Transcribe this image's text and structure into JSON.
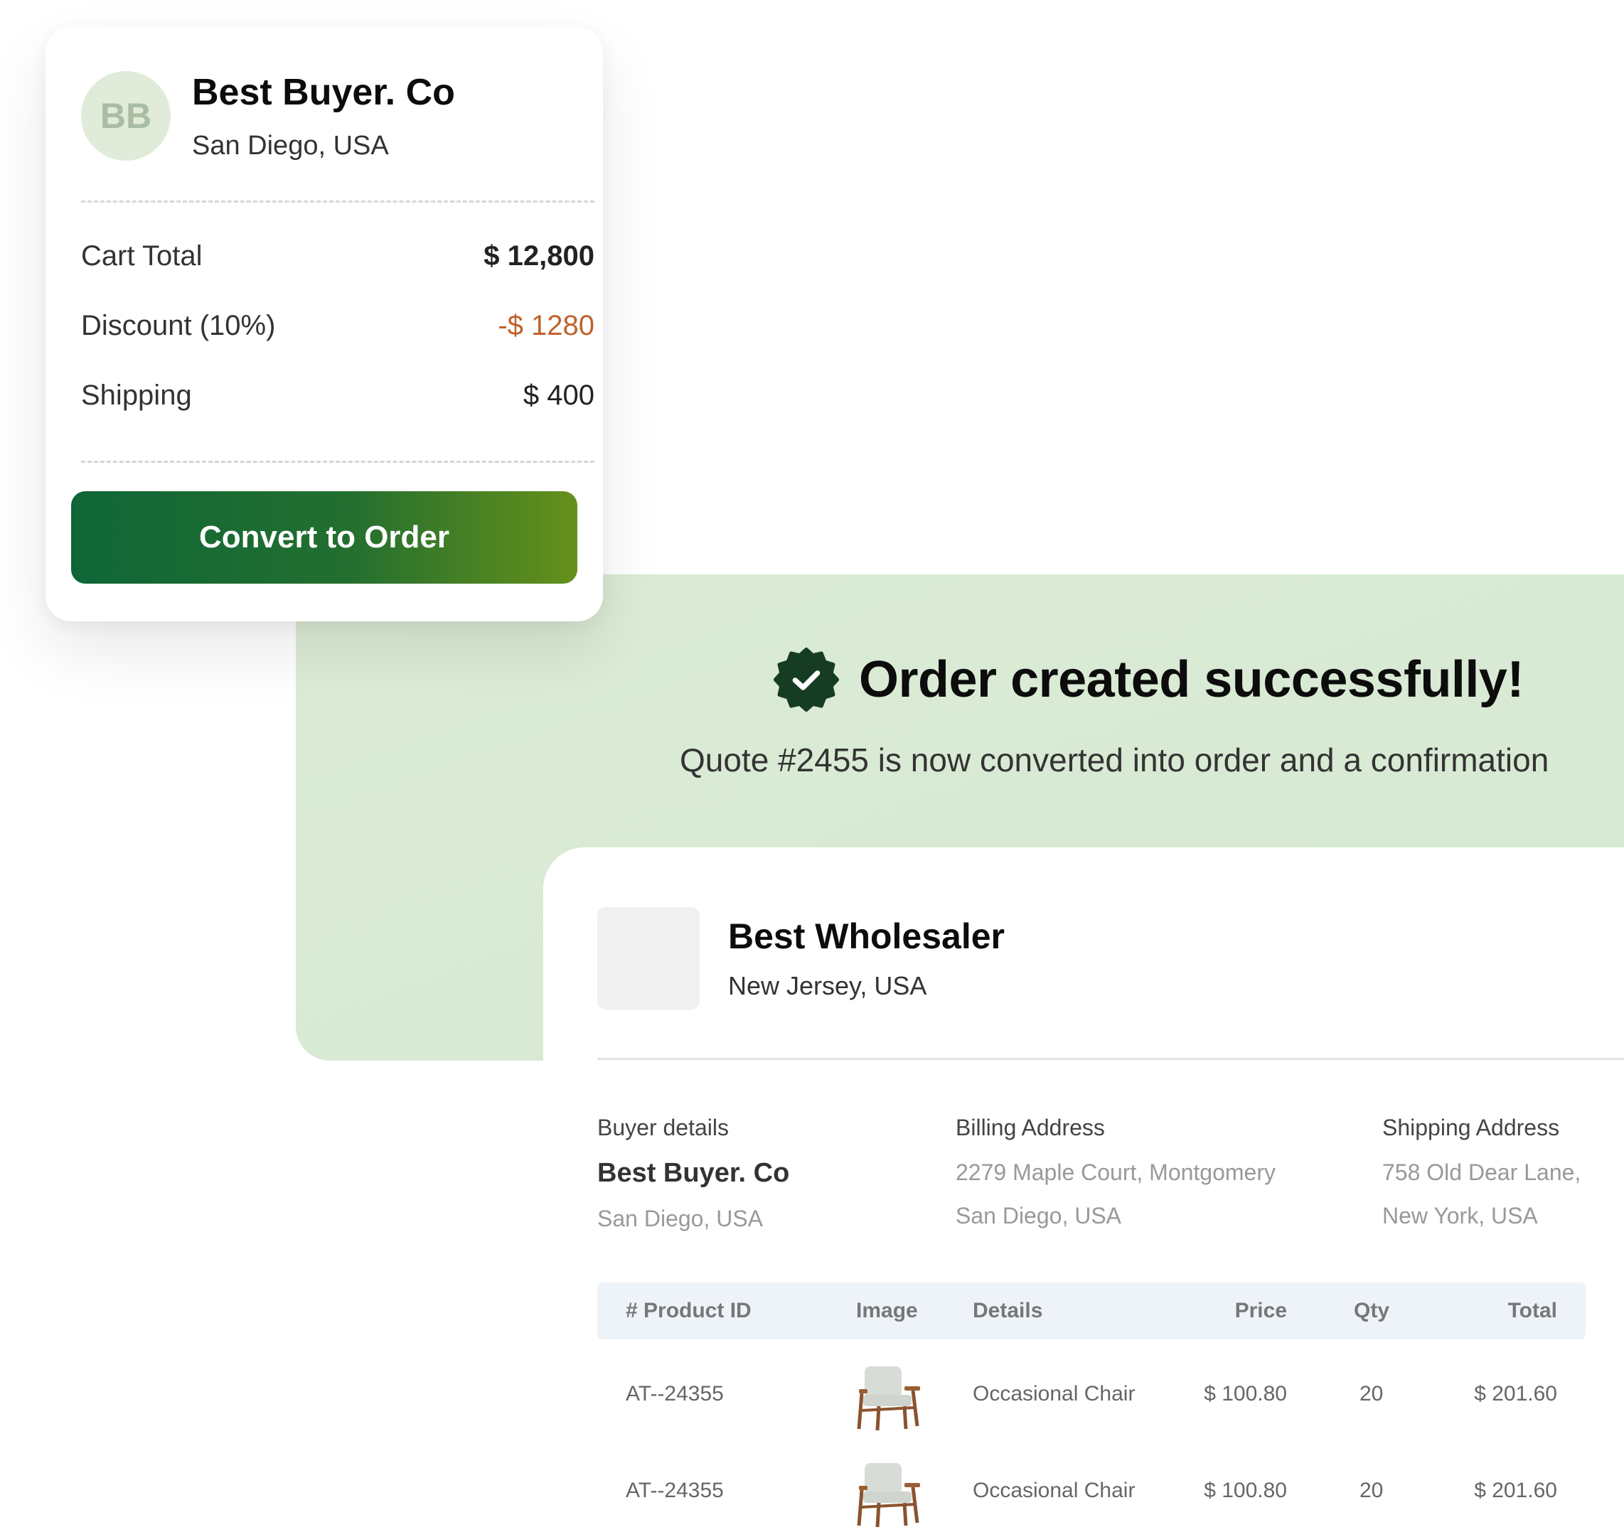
{
  "quote_card": {
    "avatar_initials": "BB",
    "buyer_name": "Best Buyer. Co",
    "buyer_location": "San Diego, USA",
    "rows": [
      {
        "label": "Cart Total",
        "value": "$ 12,800"
      },
      {
        "label": "Discount (10%)",
        "value": "-$ 1280"
      },
      {
        "label": "Shipping",
        "value": "$ 400"
      }
    ],
    "convert_label": "Convert to Order"
  },
  "success": {
    "icon": "verified-badge-check-icon",
    "title": "Order created successfully!",
    "subtitle": "Quote #2455 is now converted into order and a confirmation"
  },
  "order": {
    "seller_name": "Best Wholesaler",
    "seller_location": "New Jersey, USA",
    "buyer": {
      "heading": "Buyer details",
      "name": "Best Buyer. Co",
      "location": "San Diego, USA"
    },
    "billing": {
      "heading": "Billing Address",
      "line1": "2279 Maple Court, Montgomery",
      "line2": "San Diego, USA"
    },
    "shipping": {
      "heading": "Shipping Address",
      "line1": "758 Old Dear Lane,",
      "line2": "New York, USA"
    },
    "table": {
      "headers": [
        "# Product ID",
        "Image",
        "Details",
        "Price",
        "Qty",
        "Total"
      ],
      "rows": [
        {
          "id": "AT--24355",
          "image": "armchair-image",
          "details": "Occasional Chair",
          "price": "$ 100.80",
          "qty": "20",
          "total": "$ 201.60"
        },
        {
          "id": "AT--24355",
          "image": "armchair-image",
          "details": "Occasional Chair",
          "price": "$ 100.80",
          "qty": "20",
          "total": "$ 201.60"
        }
      ]
    }
  },
  "colors": {
    "accent_green": "#0f6637",
    "accent_lime": "#66901b",
    "discount_orange": "#c0622b",
    "panel_green": "#d8ead4",
    "badge_dark": "#163d24"
  }
}
